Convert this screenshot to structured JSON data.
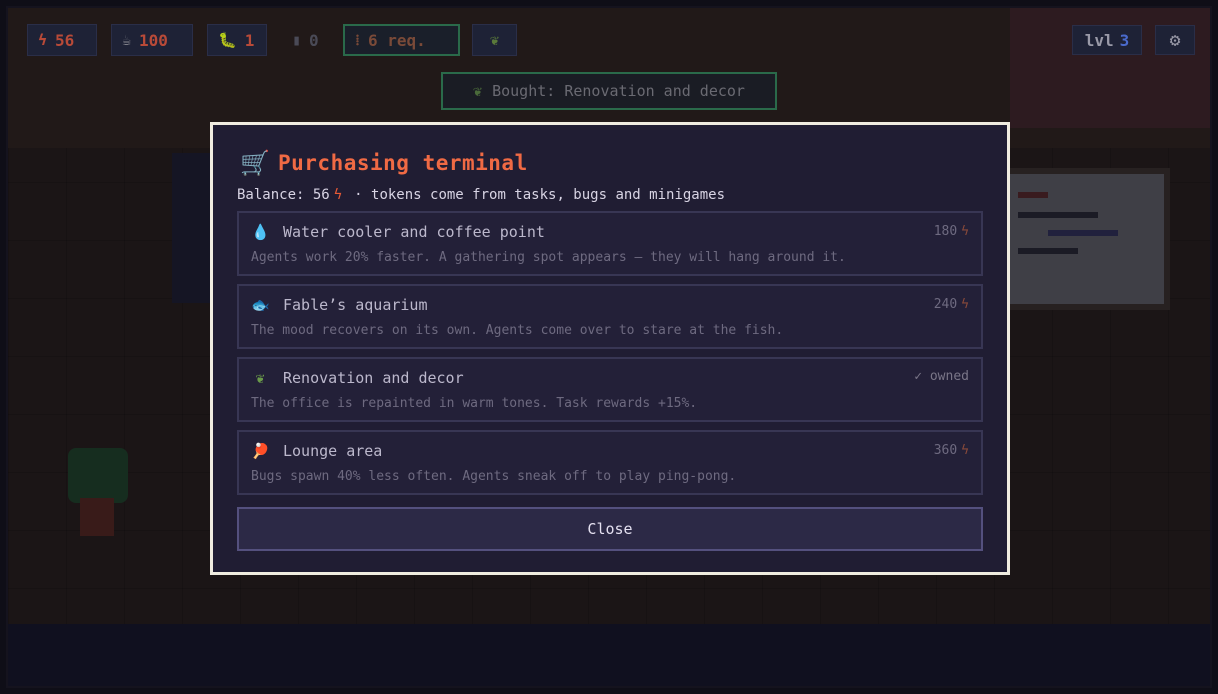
{
  "hud": {
    "tokens": "56",
    "coffee": "100",
    "bugs": "1",
    "trash": "0",
    "requests": "6 req.",
    "level_label": "lvl",
    "level_value": "3"
  },
  "icons": {
    "tokens": "bolt-icon",
    "coffee": "coffee-icon",
    "bugs": "bug-icon",
    "trash": "trash-icon",
    "requests": "request-icon",
    "decor": "leaf-icon",
    "settings": "gear-icon",
    "cart": "cart-icon"
  },
  "toast": {
    "text": "Bought: Renovation and decor"
  },
  "modal": {
    "title": "Purchasing terminal",
    "balance_label": "Balance: 56",
    "balance_note": "· tokens come from tasks, bugs and minigames",
    "items": [
      {
        "name": "Water cooler and coffee point",
        "desc": "Agents work 20% faster. A gathering spot appears — they will hang around it.",
        "price": "180",
        "owned": false
      },
      {
        "name": "Fable’s aquarium",
        "desc": "The mood recovers on its own. Agents come over to stare at the fish.",
        "price": "240",
        "owned": false
      },
      {
        "name": "Renovation and decor",
        "desc": "The office is repainted in warm tones. Task rewards +15%.",
        "status": "✓ owned",
        "owned": true
      },
      {
        "name": "Lounge area",
        "desc": "Bugs spawn 40% less often. Agents sneak off to play ping-pong.",
        "price": "360",
        "owned": false
      }
    ],
    "close_label": "Close"
  },
  "colors": {
    "accent": "#f06a44",
    "token": "#e85a36",
    "panel": "#201d33",
    "border": "#f0ece0"
  }
}
